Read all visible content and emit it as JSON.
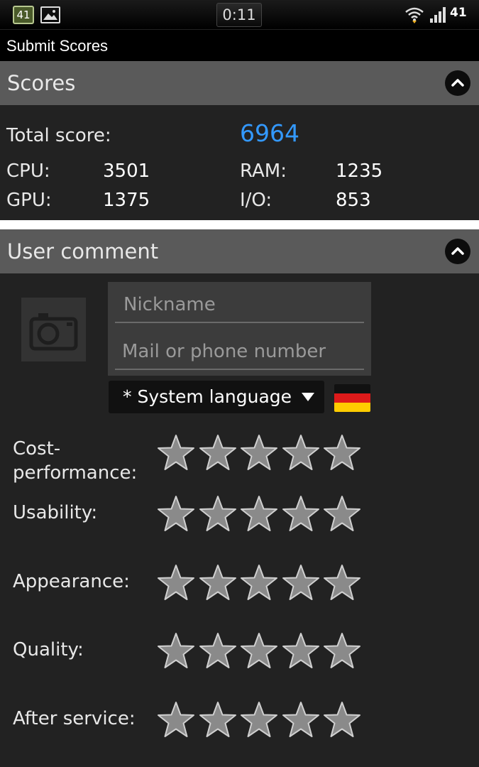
{
  "status_bar": {
    "notification_badge": "41",
    "notification_icons": [
      "app-badge-icon",
      "image-icon"
    ],
    "time": "0:11",
    "wifi_icon": "wifi-icon",
    "signal_icon": "signal-bars-icon",
    "signal_value": "41"
  },
  "app_bar": {
    "title": "Submit Scores"
  },
  "scores": {
    "header": "Scores",
    "collapse_icon": "chevron-up-icon",
    "total_label": "Total score:",
    "total_value": "6964",
    "total_color": "#3399ff",
    "cpu_label": "CPU:",
    "cpu_value": "3501",
    "gpu_label": "GPU:",
    "gpu_value": "1375",
    "ram_label": "RAM:",
    "ram_value": "1235",
    "io_label": "I/O:",
    "io_value": "853"
  },
  "user_comment": {
    "header": "User comment",
    "collapse_icon": "chevron-up-icon",
    "avatar_icon": "camera-icon",
    "nickname_placeholder": "Nickname",
    "contact_placeholder": "Mail or phone number",
    "language_selected": "* System language",
    "language_flag": "germany-flag-icon",
    "ratings": [
      {
        "label_line1": "Cost-",
        "label_line2": "performance:",
        "stars_filled": 0,
        "stars_total": 5
      },
      {
        "label_line1": "Usability:",
        "stars_filled": 0,
        "stars_total": 5
      },
      {
        "label_line1": "Appearance:",
        "stars_filled": 0,
        "stars_total": 5
      },
      {
        "label_line1": "Quality:",
        "stars_filled": 0,
        "stars_total": 5
      },
      {
        "label_line1": "After service:",
        "stars_filled": 0,
        "stars_total": 5
      }
    ]
  }
}
